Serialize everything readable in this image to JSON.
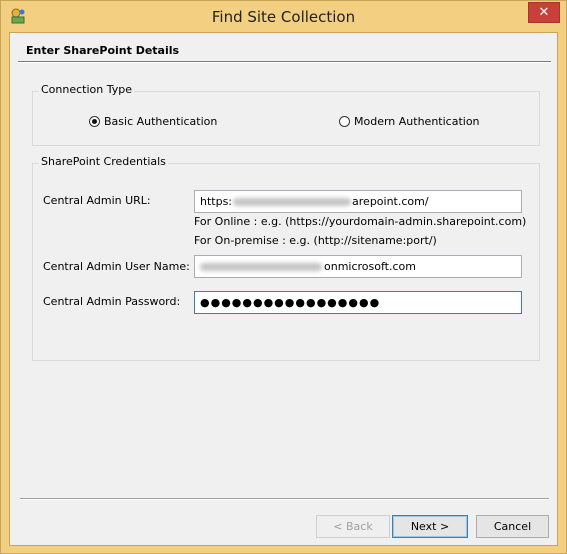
{
  "window": {
    "title": "Find Site Collection",
    "close_glyph": "✕",
    "icon": "app-icon"
  },
  "header": {
    "label": "Enter SharePoint Details"
  },
  "connection_type": {
    "title": "Connection Type",
    "options": [
      {
        "label": "Basic Authentication",
        "selected": true
      },
      {
        "label": "Modern Authentication",
        "selected": false
      }
    ]
  },
  "credentials": {
    "title": "SharePoint Credentials",
    "url_label": "Central Admin URL:",
    "url_value_prefix": "https:",
    "url_value_suffix": "arepoint.com/",
    "hint_online": "For Online : e.g. (https://yourdomain-admin.sharepoint.com)",
    "hint_onpremise": "For On-premise : e.g. (http://sitename:port/)",
    "username_label": "Central Admin User Name:",
    "username_value_suffix": "onmicrosoft.com",
    "password_label": "Central Admin Password:",
    "password_value": "●●●●●●●●●●●●●●●●●"
  },
  "footer": {
    "back_label": "< Back",
    "next_label": "Next >",
    "cancel_label": "Cancel"
  }
}
